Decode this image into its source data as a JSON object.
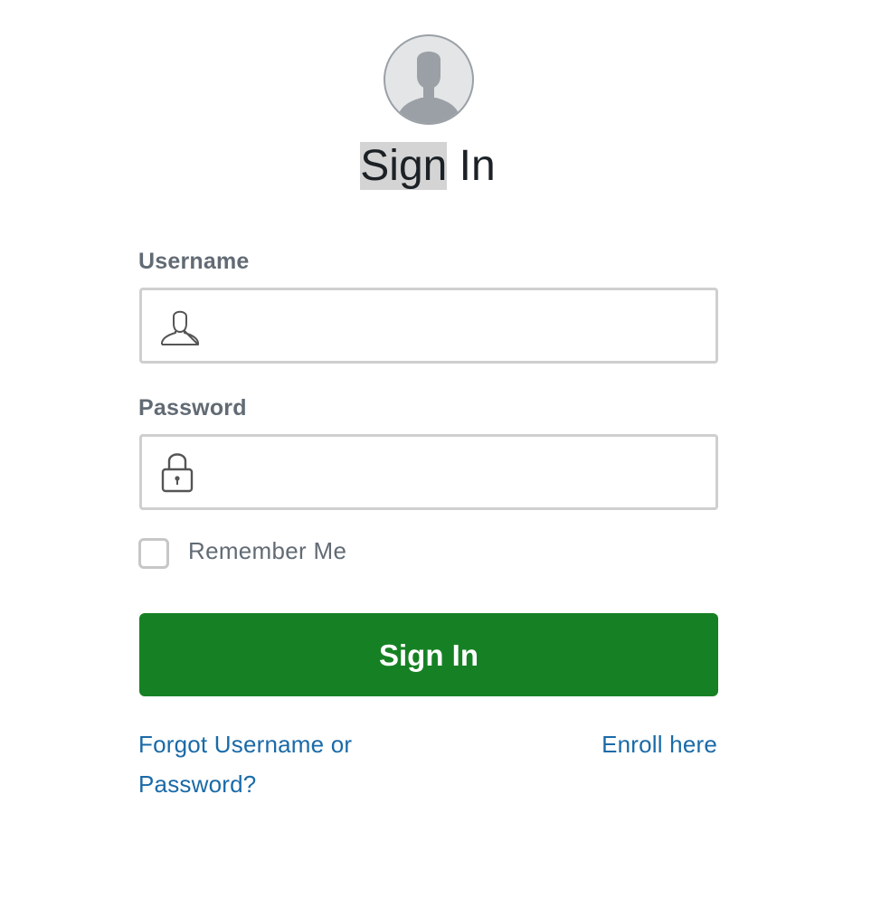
{
  "header": {
    "avatar_icon": "user-silhouette-icon",
    "title_part1": "Sign",
    "title_part2": " In"
  },
  "form": {
    "username": {
      "label": "Username",
      "value": "",
      "placeholder": "",
      "icon": "user-outline-icon"
    },
    "password": {
      "label": "Password",
      "value": "",
      "placeholder": "",
      "icon": "lock-icon"
    },
    "remember_me": {
      "label": "Remember Me",
      "checked": false
    },
    "submit_label": "Sign In"
  },
  "links": {
    "forgot": "Forgot Username or Password?",
    "enroll": "Enroll here"
  },
  "colors": {
    "primary_button": "#168124",
    "link": "#1a6aa8",
    "label": "#626b74",
    "input_border": "#cfcfcf"
  }
}
